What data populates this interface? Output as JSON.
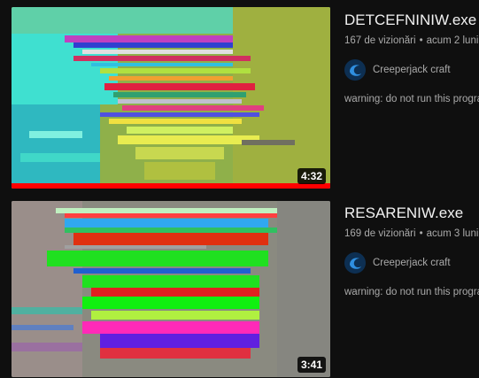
{
  "videos": [
    {
      "title": "DETCEFNINIW.exe",
      "views": "167 de vizionări",
      "age": "acum 2 luni",
      "channel": "Creeperjack craft",
      "description": "warning: do not run this program on real machine",
      "duration": "4:32",
      "watched_fraction": 1.0
    },
    {
      "title": "RESARENIW.exe",
      "views": "169 de vizionări",
      "age": "acum 3 luni",
      "channel": "Creeperjack craft",
      "description": "warning: do not run this program on real machine",
      "duration": "3:41",
      "watched_fraction": 0
    }
  ],
  "separator": "•",
  "icons": {
    "avatar": "channel-avatar-icon"
  }
}
